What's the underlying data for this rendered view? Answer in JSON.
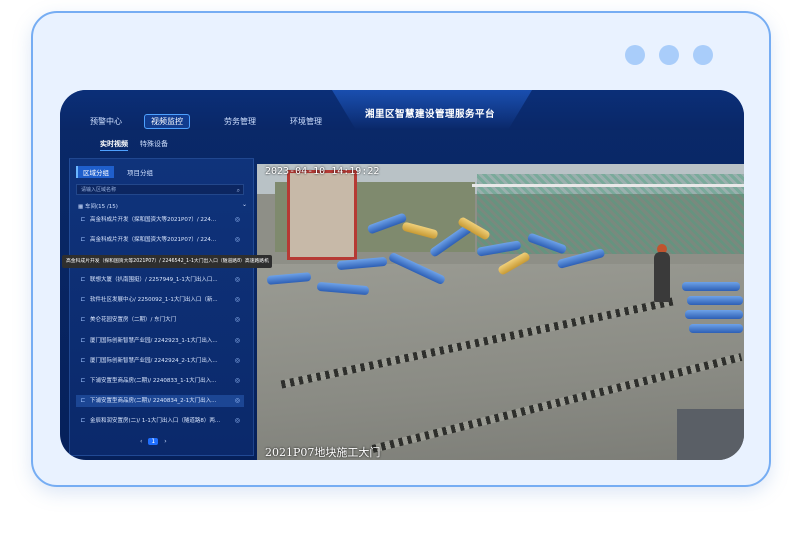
{
  "platform_title": "湘里区智慧建设管理服务平台",
  "nav": [
    {
      "label": "预警中心",
      "active": false
    },
    {
      "label": "视频监控",
      "active": true
    },
    {
      "label": "劳务管理",
      "active": false
    },
    {
      "label": "环境管理",
      "active": false
    }
  ],
  "subnav": [
    {
      "label": "实时视频",
      "active": true
    },
    {
      "label": "特殊设备",
      "active": false
    }
  ],
  "sidebar": {
    "tabs": [
      "区域分组",
      "项目分组"
    ],
    "search_placeholder": "请输入区域名称",
    "root_label": "车间(15 /15)",
    "items": [
      "高金科成片开发（探和国资大等2021P07）/ 224...",
      "高金科成片开发（探和国资大等2021P07）/ 224...",
      "",
      "联想大厦（扒南围挺）/ 2257949_1-1大门出入口...",
      "软件社区发展中心/ 2250092_1-1大门出入口（新...",
      "美仑花园安置房（二期）/ 东门大门",
      "厦门国际创新智慧产业园/ 2242923_1-1大门出入...",
      "厦门国际创新智慧产业园/ 2242924_2-1大门出入...",
      "下浦安置型商品房(二期)/ 2240833_1-1大门出入...",
      "下浦安置型商品房(二期)/ 2240834_2-1大门出入...",
      "金辰和润安置房(二)/ 1-1大门出入口（隧道路8）两..."
    ],
    "tooltip": "高金科成片开发（探和国资大等2021P07）/ 2246542_1-1大门出入口（隧道路8）高速路路机",
    "pager": {
      "prev": "‹",
      "page": "1",
      "next": "›"
    }
  },
  "video": {
    "timestamp": "2023-04-10  14:19:22",
    "caption": "2021P07地块施工大门"
  },
  "colors": {
    "frame_border": "#76adf3",
    "frame_bg": "#e9f2ff",
    "accent": "#1f6fff"
  }
}
